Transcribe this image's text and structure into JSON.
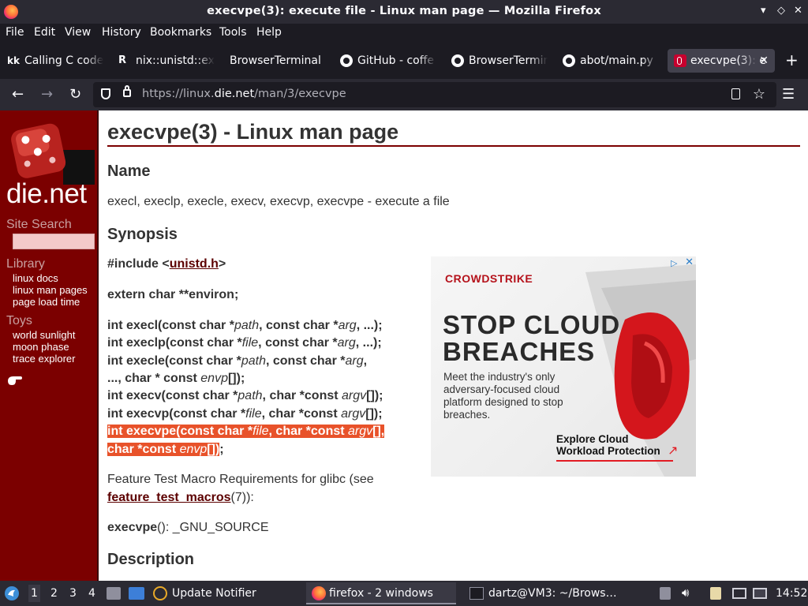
{
  "window": {
    "title": "execvpe(3): execute file - Linux man page — Mozilla Firefox",
    "controls": {
      "minimize": "▾",
      "restore": "◇",
      "close": "✕"
    }
  },
  "menu": [
    "File",
    "Edit",
    "View",
    "History",
    "Bookmarks",
    "Tools",
    "Help"
  ],
  "tabs": [
    {
      "label": "Calling C code",
      "icon": "kk-icon",
      "icon_text": "kk"
    },
    {
      "label": "nix::unistd::ex",
      "icon": "nix-icon",
      "icon_text": "R"
    },
    {
      "label": "BrowserTerminal",
      "icon": "none"
    },
    {
      "label": "GitHub - coffe",
      "icon": "github-icon"
    },
    {
      "label": "BrowserTermin",
      "icon": "github-icon"
    },
    {
      "label": "abot/main.py",
      "icon": "github-icon"
    },
    {
      "label": "execvpe(3): e",
      "icon": "dienet-icon",
      "active": true
    }
  ],
  "nav": {
    "url_prefix": "https://linux.",
    "url_domain": "die.net",
    "url_path": "/man/3/execvpe"
  },
  "sidebar": {
    "site_name": "die.net",
    "search_label": "Site Search",
    "library_heading": "Library",
    "library_links": [
      "linux docs",
      "linux man pages",
      "page load time"
    ],
    "toys_heading": "Toys",
    "toys_links": [
      "world sunlight",
      "moon phase",
      "trace explorer"
    ]
  },
  "page": {
    "title": "execvpe(3) - Linux man page",
    "name_heading": "Name",
    "name_text": "execl, execlp, execle, execv, execvp, execvpe - execute a file",
    "synopsis_heading": "Synopsis",
    "include_prefix": "#include <",
    "include_link": "unistd.h",
    "include_suffix": ">",
    "extern_line": "extern char **environ;",
    "feature_text_1": "Feature Test Macro Requirements for glibc (see",
    "feature_link": "feature_test_macros",
    "feature_text_2": "(7)):",
    "execvpe_label": "execvpe",
    "execvpe_rest": "(): _GNU_SOURCE",
    "description_heading": "Description"
  },
  "ad": {
    "brand": "CROWDSTRIKE",
    "headline_1": "STOP CLOUD",
    "headline_2": "BREACHES",
    "body": "Meet the industry's only adversary-focused cloud platform designed to stop breaches.",
    "cta": "Explore Cloud Workload Protection",
    "arrow": "↗",
    "adchoices": "▷",
    "close": "✕"
  },
  "taskbar": {
    "workspaces": [
      "1",
      "2",
      "3",
      "4"
    ],
    "update_notifier": "Update Notifier",
    "firefox": "firefox - 2 windows",
    "terminal": "dartz@VM3: ~/Brows…",
    "clock": "14:52"
  }
}
